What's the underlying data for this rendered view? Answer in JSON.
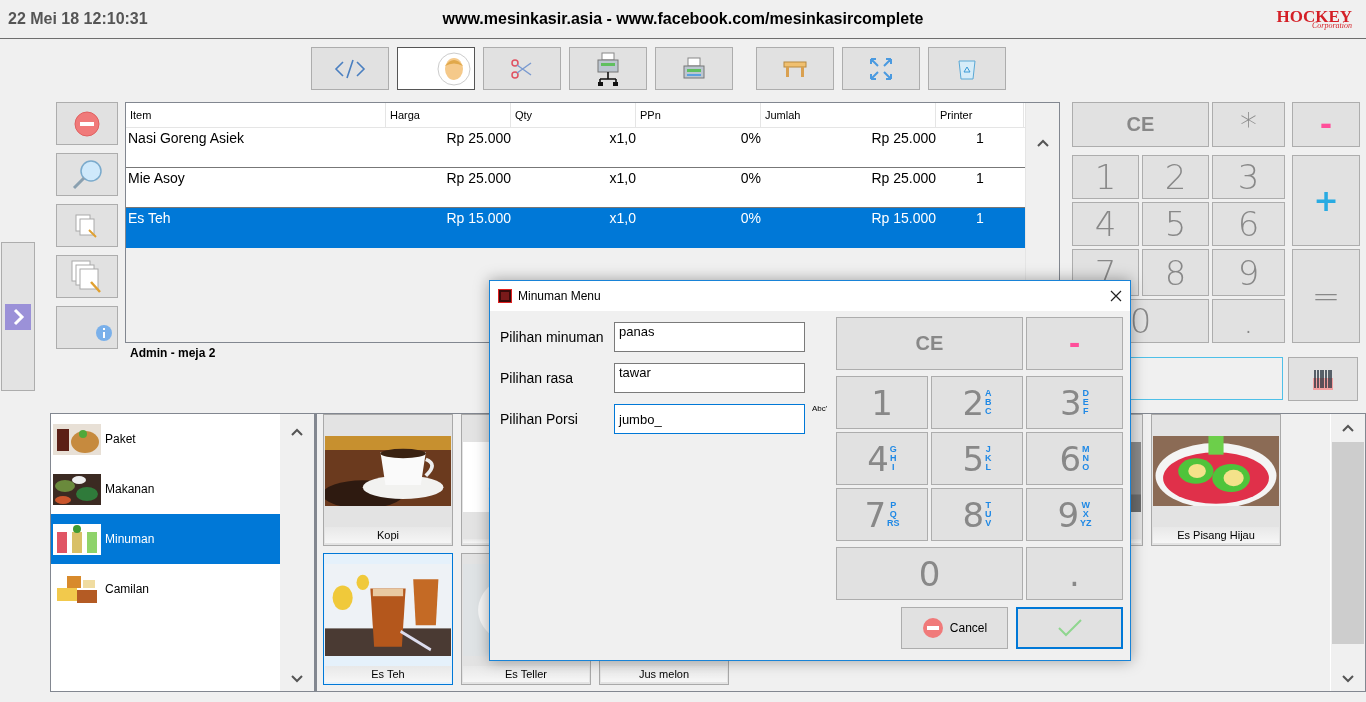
{
  "header": {
    "datetime": "22 Mei 18 12:10:31",
    "title": "www.mesinkasir.asia - www.facebook.com/mesinkasircomplete",
    "logo": "HOCKEY",
    "logo_sub": "Corporation"
  },
  "order_table": {
    "columns": [
      "Item",
      "Harga",
      "Qty",
      "PPn",
      "Jumlah",
      "Printer"
    ],
    "rows": [
      {
        "item": "Nasi Goreng Asiek",
        "harga": "Rp 25.000",
        "qty": "x1,0",
        "ppn": "0%",
        "jumlah": "Rp 25.000",
        "printer": "1",
        "selected": false
      },
      {
        "item": "Mie Asoy",
        "harga": "Rp 25.000",
        "qty": "x1,0",
        "ppn": "0%",
        "jumlah": "Rp 25.000",
        "printer": "1",
        "selected": false
      },
      {
        "item": "Es Teh",
        "harga": "Rp 15.000",
        "qty": "x1,0",
        "ppn": "0%",
        "jumlah": "Rp 15.000",
        "printer": "1",
        "selected": true
      }
    ]
  },
  "user_label": "Admin - meja 2",
  "keypad": {
    "keys": [
      {
        "label": "CE"
      },
      {
        "label": "*"
      },
      {
        "label": "-",
        "color": "#ff4f9a"
      },
      {
        "label": "1"
      },
      {
        "label": "2"
      },
      {
        "label": "3"
      },
      {
        "label": "+",
        "color": "#29abe2"
      },
      {
        "label": "4"
      },
      {
        "label": "5"
      },
      {
        "label": "6"
      },
      {
        "label": "7"
      },
      {
        "label": "8"
      },
      {
        "label": "9"
      },
      {
        "label": "="
      },
      {
        "label": "0"
      },
      {
        "label": "."
      }
    ]
  },
  "categories": [
    {
      "name": "Paket",
      "selected": false
    },
    {
      "name": "Makanan",
      "selected": false
    },
    {
      "name": "Minuman",
      "selected": true
    },
    {
      "name": "Camilan",
      "selected": false
    }
  ],
  "products": [
    {
      "kind": "item",
      "name": "Kopi",
      "selected": false
    },
    {
      "kind": "item",
      "selected": false
    },
    {
      "kind": "blank"
    },
    {
      "kind": "blank"
    },
    {
      "kind": "blank"
    },
    {
      "kind": "item",
      "selected": false
    },
    {
      "kind": "item",
      "name": "Es Pisang Hijau",
      "selected": false
    },
    {
      "kind": "item",
      "name": "Es Teh",
      "selected": true
    },
    {
      "kind": "item",
      "name": "Es Teller",
      "selected": false
    },
    {
      "kind": "item",
      "name": "Jus melon",
      "selected": false
    }
  ],
  "dialog": {
    "title": "Minuman Menu",
    "fields": [
      {
        "label": "Pilihan minuman",
        "value": "panas",
        "focused": false
      },
      {
        "label": "Pilihan rasa",
        "value": "tawar",
        "focused": false
      },
      {
        "label": "Pilihan Porsi",
        "value": "jumbo_",
        "focused": true
      }
    ],
    "input_mode": "Abc'",
    "keypad": {
      "keys": [
        {
          "label": "CE"
        },
        {
          "label": "-",
          "color": "#ff4f9a"
        },
        {
          "label": "1"
        },
        {
          "label": "2",
          "letters": [
            "A",
            "B",
            "C"
          ]
        },
        {
          "label": "3",
          "letters": [
            "D",
            "E",
            "F"
          ]
        },
        {
          "label": "4",
          "letters": [
            "G",
            "H",
            "I"
          ]
        },
        {
          "label": "5",
          "letters": [
            "J",
            "K",
            "L"
          ]
        },
        {
          "label": "6",
          "letters": [
            "M",
            "N",
            "O"
          ]
        },
        {
          "label": "7",
          "letters": [
            "P",
            "Q",
            "RS"
          ]
        },
        {
          "label": "8",
          "letters": [
            "T",
            "U",
            "V"
          ]
        },
        {
          "label": "9",
          "letters": [
            "W",
            "X",
            "YZ"
          ]
        },
        {
          "label": "0"
        },
        {
          "label": "."
        }
      ]
    },
    "cancel": "Cancel"
  }
}
